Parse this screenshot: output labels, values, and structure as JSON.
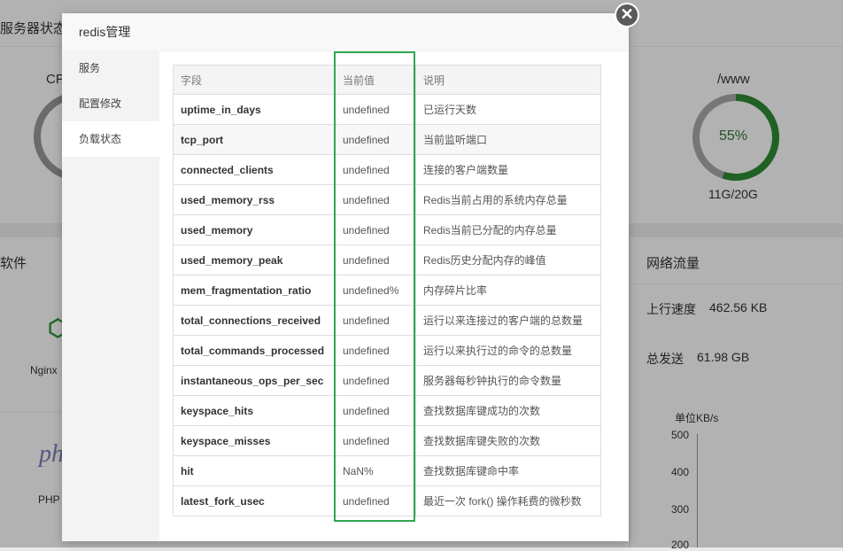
{
  "background": {
    "server_status_label": "服务器状态",
    "cpu_label": "CP",
    "disk_path": "/www",
    "disk_percent": "55%",
    "disk_percent_value": 55,
    "disk_usage": "11G/20G",
    "software_label": "软件",
    "nginx_label": "Nginx",
    "php_logo": "ph",
    "php_label": "PHP",
    "network_label": "网络流量",
    "upload_speed_label": "上行速度",
    "upload_speed_value": "462.56 KB",
    "total_sent_label": "总发送",
    "total_sent_value": "61.98 GB",
    "chart_unit": "单位KB/s",
    "chart_ticks": [
      "500",
      "400",
      "300",
      "200"
    ]
  },
  "modal": {
    "title": "redis管理",
    "close_glyph": "✕",
    "sidebar": [
      {
        "label": "服务",
        "active": false
      },
      {
        "label": "配置修改",
        "active": false
      },
      {
        "label": "负载状态",
        "active": true
      }
    ],
    "table": {
      "headers": [
        "字段",
        "当前值",
        "说明"
      ],
      "rows": [
        {
          "field": "uptime_in_days",
          "value": "undefined",
          "desc": "已运行天数"
        },
        {
          "field": "tcp_port",
          "value": "undefined",
          "desc": "当前监听端口"
        },
        {
          "field": "connected_clients",
          "value": "undefined",
          "desc": "连接的客户端数量"
        },
        {
          "field": "used_memory_rss",
          "value": "undefined",
          "desc": "Redis当前占用的系统内存总量"
        },
        {
          "field": "used_memory",
          "value": "undefined",
          "desc": "Redis当前已分配的内存总量"
        },
        {
          "field": "used_memory_peak",
          "value": "undefined",
          "desc": "Redis历史分配内存的峰值"
        },
        {
          "field": "mem_fragmentation_ratio",
          "value": "undefined%",
          "desc": "内存碎片比率"
        },
        {
          "field": "total_connections_received",
          "value": "undefined",
          "desc": "运行以来连接过的客户端的总数量"
        },
        {
          "field": "total_commands_processed",
          "value": "undefined",
          "desc": "运行以来执行过的命令的总数量"
        },
        {
          "field": "instantaneous_ops_per_sec",
          "value": "undefined",
          "desc": "服务器每秒钟执行的命令数量"
        },
        {
          "field": "keyspace_hits",
          "value": "undefined",
          "desc": "查找数据库键成功的次数"
        },
        {
          "field": "keyspace_misses",
          "value": "undefined",
          "desc": "查找数据库键失败的次数"
        },
        {
          "field": "hit",
          "value": "NaN%",
          "desc": "查找数据库键命中率"
        },
        {
          "field": "latest_fork_usec",
          "value": "undefined",
          "desc": "最近一次 fork() 操作耗费的微秒数"
        }
      ]
    }
  }
}
